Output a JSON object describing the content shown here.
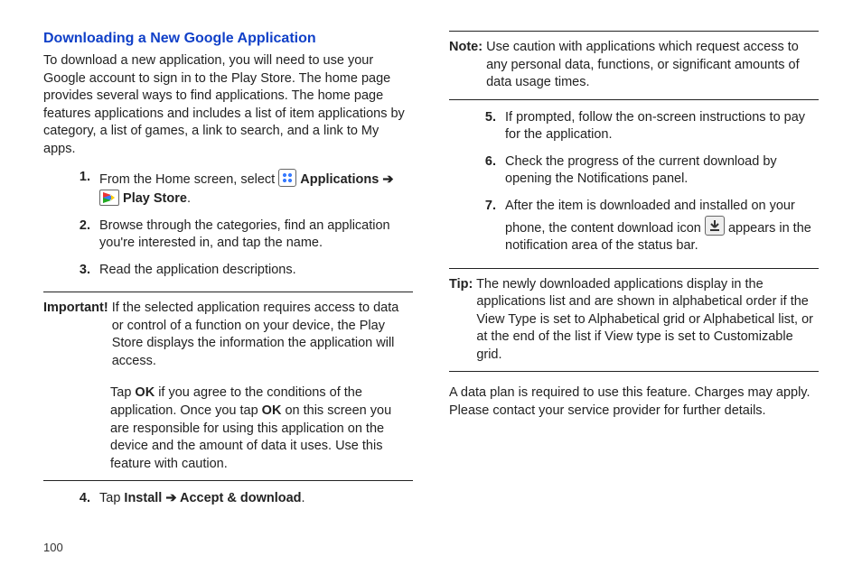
{
  "pageNumber": "100",
  "left": {
    "title": "Downloading a New Google Application",
    "intro": "To download a new application, you will need to use your Google account to sign in to the Play Store. The home page provides several ways to find applications. The home page features applications and includes a list of item applications by category, a list of games, a link to search, and a link to My apps.",
    "step1_pre": "From the Home screen, select ",
    "step1_apps": "Applications",
    "step1_arrow": " ➔",
    "step1_play": " Play Store",
    "step2": "Browse through the categories, find an application you're interested in, and tap the name.",
    "step3": "Read the application descriptions.",
    "important_lead": "Important!",
    "important_text": " If the selected application requires access to data or control of a function on your device, the Play Store displays the information the application will access.",
    "important_para2_a": "Tap ",
    "important_para2_ok1": "OK",
    "important_para2_b": " if you agree to the conditions of the application. Once you tap ",
    "important_para2_ok2": "OK",
    "important_para2_c": " on this screen you are responsible for using this application on the device and the amount of data it uses. Use this feature with caution.",
    "step4_pre": "Tap ",
    "step4_install": "Install",
    "step4_arrow": " ➔ ",
    "step4_accept": "Accept & download"
  },
  "right": {
    "note_lead": "Note:",
    "note_text": " Use caution with applications which request access to any personal data, functions, or significant amounts of data usage times.",
    "step5": "If prompted, follow the on-screen instructions to pay for the application.",
    "step6": "Check the progress of the current download by opening the Notifications panel.",
    "step7_a": "After the item is downloaded and installed on your phone, the content download icon ",
    "step7_b": " appears in the notification area of the status bar.",
    "tip_lead": "Tip:",
    "tip_text": " The newly downloaded applications display in the applications list and are shown in alphabetical order if the View Type is set to Alphabetical grid or Alphabetical list, or at the end of the list if View type is set to Customizable grid.",
    "closing": "A data plan is required to use this feature. Charges may apply. Please contact your service provider for further details."
  }
}
